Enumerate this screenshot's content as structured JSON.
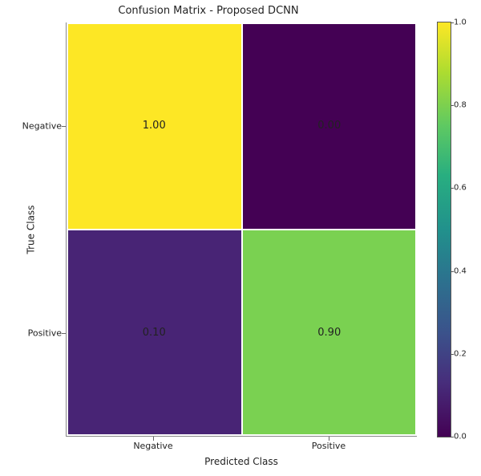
{
  "chart_data": {
    "type": "heatmap",
    "title": "Confusion Matrix - Proposed DCNN",
    "xlabel": "Predicted Class",
    "ylabel": "True Class",
    "x_categories": [
      "Negative",
      "Positive"
    ],
    "y_categories": [
      "Negative",
      "Positive"
    ],
    "values": [
      [
        1.0,
        0.0
      ],
      [
        0.1,
        0.9
      ]
    ],
    "value_labels": [
      [
        "1.00",
        "0.00"
      ],
      [
        "0.10",
        "0.90"
      ]
    ],
    "cell_colors": [
      [
        "#fde725",
        "#440154"
      ],
      [
        "#482475",
        "#7ad151"
      ]
    ],
    "cell_text_colors": [
      [
        "#000000",
        "#000000"
      ],
      [
        "#000000",
        "#000000"
      ]
    ],
    "colorbar": {
      "min": 0.0,
      "max": 1.0,
      "ticks": [
        "0.0",
        "0.2",
        "0.4",
        "0.6",
        "0.8",
        "1.0"
      ],
      "gradient_stops": [
        {
          "pos": 0.0,
          "color": "#440154"
        },
        {
          "pos": 0.13,
          "color": "#472d7b"
        },
        {
          "pos": 0.25,
          "color": "#3b528b"
        },
        {
          "pos": 0.38,
          "color": "#2c728e"
        },
        {
          "pos": 0.5,
          "color": "#21918c"
        },
        {
          "pos": 0.63,
          "color": "#28ae80"
        },
        {
          "pos": 0.75,
          "color": "#5ec962"
        },
        {
          "pos": 0.88,
          "color": "#addc30"
        },
        {
          "pos": 1.0,
          "color": "#fde725"
        }
      ]
    }
  }
}
